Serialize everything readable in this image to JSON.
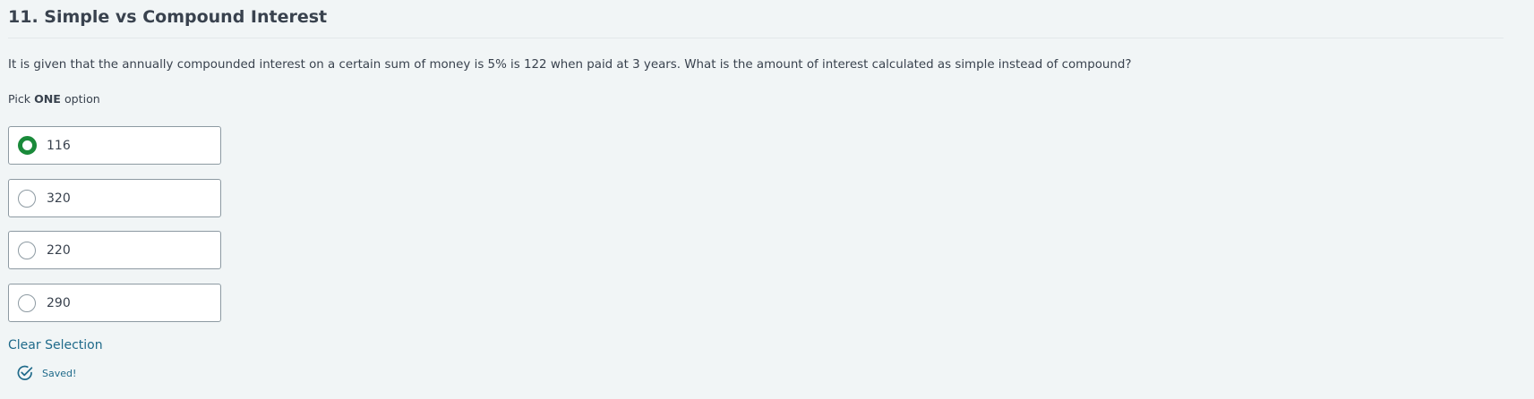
{
  "question": {
    "title": "11. Simple vs Compound Interest",
    "text": "It is given that the annually compounded interest on a certain sum of money is 5% is 122 when paid at 3 years.  What is the amount of interest calculated as simple instead of compound?",
    "pick_prefix": "Pick",
    "pick_strong": "ONE",
    "pick_suffix": "option"
  },
  "options": [
    {
      "label": "116",
      "selected": true
    },
    {
      "label": "320",
      "selected": false
    },
    {
      "label": "220",
      "selected": false
    },
    {
      "label": "290",
      "selected": false
    }
  ],
  "actions": {
    "clear_label": "Clear Selection"
  },
  "status": {
    "saved_label": "Saved!",
    "icon": "check-circle-icon"
  },
  "colors": {
    "background": "#f1f5f6",
    "text": "#39424e",
    "selected_radio": "#1a8a3a",
    "link": "#1f6a8a",
    "border": "#8d9aa2"
  }
}
